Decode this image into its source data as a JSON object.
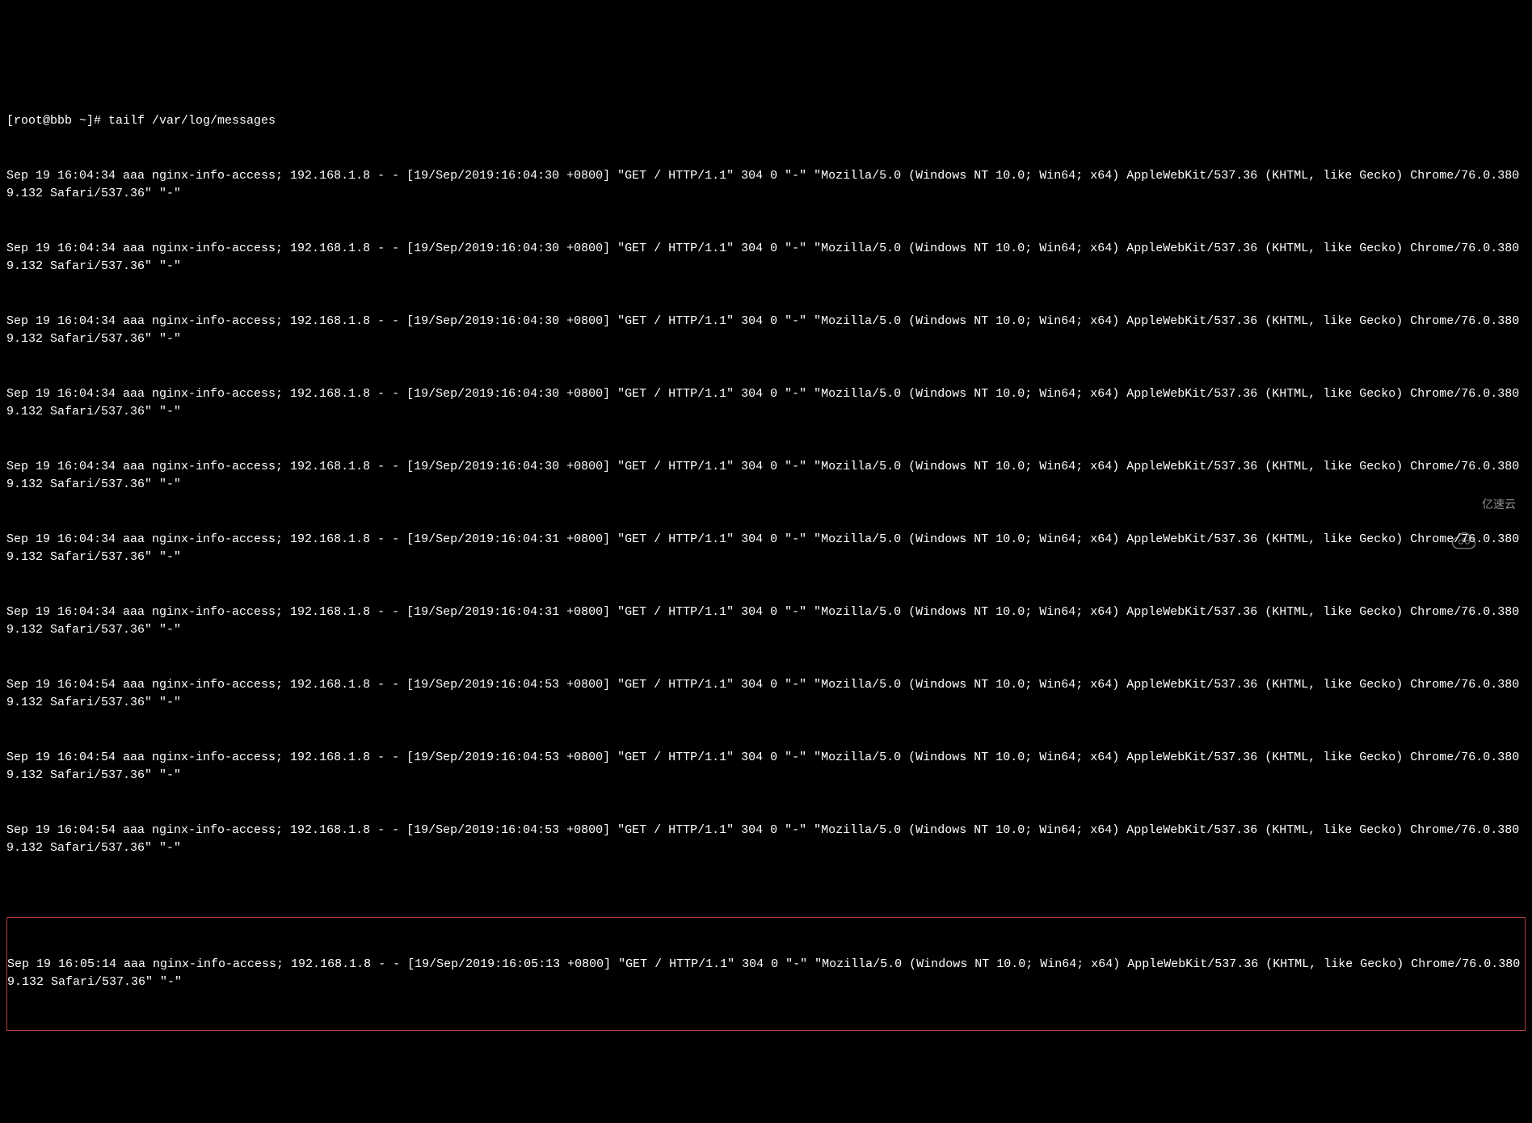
{
  "terminal": {
    "prompt": "[root@bbb ~]# tailf /var/log/messages",
    "log_lines": [
      "Sep 19 16:04:34 aaa nginx-info-access; 192.168.1.8 - - [19/Sep/2019:16:04:30 +0800] \"GET / HTTP/1.1\" 304 0 \"-\" \"Mozilla/5.0 (Windows NT 10.0; Win64; x64) AppleWebKit/537.36 (KHTML, like Gecko) Chrome/76.0.3809.132 Safari/537.36\" \"-\"",
      "Sep 19 16:04:34 aaa nginx-info-access; 192.168.1.8 - - [19/Sep/2019:16:04:30 +0800] \"GET / HTTP/1.1\" 304 0 \"-\" \"Mozilla/5.0 (Windows NT 10.0; Win64; x64) AppleWebKit/537.36 (KHTML, like Gecko) Chrome/76.0.3809.132 Safari/537.36\" \"-\"",
      "Sep 19 16:04:34 aaa nginx-info-access; 192.168.1.8 - - [19/Sep/2019:16:04:30 +0800] \"GET / HTTP/1.1\" 304 0 \"-\" \"Mozilla/5.0 (Windows NT 10.0; Win64; x64) AppleWebKit/537.36 (KHTML, like Gecko) Chrome/76.0.3809.132 Safari/537.36\" \"-\"",
      "Sep 19 16:04:34 aaa nginx-info-access; 192.168.1.8 - - [19/Sep/2019:16:04:30 +0800] \"GET / HTTP/1.1\" 304 0 \"-\" \"Mozilla/5.0 (Windows NT 10.0; Win64; x64) AppleWebKit/537.36 (KHTML, like Gecko) Chrome/76.0.3809.132 Safari/537.36\" \"-\"",
      "Sep 19 16:04:34 aaa nginx-info-access; 192.168.1.8 - - [19/Sep/2019:16:04:30 +0800] \"GET / HTTP/1.1\" 304 0 \"-\" \"Mozilla/5.0 (Windows NT 10.0; Win64; x64) AppleWebKit/537.36 (KHTML, like Gecko) Chrome/76.0.3809.132 Safari/537.36\" \"-\"",
      "Sep 19 16:04:34 aaa nginx-info-access; 192.168.1.8 - - [19/Sep/2019:16:04:31 +0800] \"GET / HTTP/1.1\" 304 0 \"-\" \"Mozilla/5.0 (Windows NT 10.0; Win64; x64) AppleWebKit/537.36 (KHTML, like Gecko) Chrome/76.0.3809.132 Safari/537.36\" \"-\"",
      "Sep 19 16:04:34 aaa nginx-info-access; 192.168.1.8 - - [19/Sep/2019:16:04:31 +0800] \"GET / HTTP/1.1\" 304 0 \"-\" \"Mozilla/5.0 (Windows NT 10.0; Win64; x64) AppleWebKit/537.36 (KHTML, like Gecko) Chrome/76.0.3809.132 Safari/537.36\" \"-\"",
      "Sep 19 16:04:54 aaa nginx-info-access; 192.168.1.8 - - [19/Sep/2019:16:04:53 +0800] \"GET / HTTP/1.1\" 304 0 \"-\" \"Mozilla/5.0 (Windows NT 10.0; Win64; x64) AppleWebKit/537.36 (KHTML, like Gecko) Chrome/76.0.3809.132 Safari/537.36\" \"-\"",
      "Sep 19 16:04:54 aaa nginx-info-access; 192.168.1.8 - - [19/Sep/2019:16:04:53 +0800] \"GET / HTTP/1.1\" 304 0 \"-\" \"Mozilla/5.0 (Windows NT 10.0; Win64; x64) AppleWebKit/537.36 (KHTML, like Gecko) Chrome/76.0.3809.132 Safari/537.36\" \"-\"",
      "Sep 19 16:04:54 aaa nginx-info-access; 192.168.1.8 - - [19/Sep/2019:16:04:53 +0800] \"GET / HTTP/1.1\" 304 0 \"-\" \"Mozilla/5.0 (Windows NT 10.0; Win64; x64) AppleWebKit/537.36 (KHTML, like Gecko) Chrome/76.0.3809.132 Safari/537.36\" \"-\""
    ],
    "highlighted_line": "Sep 19 16:05:14 aaa nginx-info-access; 192.168.1.8 - - [19/Sep/2019:16:05:13 +0800] \"GET / HTTP/1.1\" 304 0 \"-\" \"Mozilla/5.0 (Windows NT 10.0; Win64; x64) AppleWebKit/537.36 (KHTML, like Gecko) Chrome/76.0.3809.132 Safari/537.36\" \"-\""
  },
  "watermark": {
    "text": "亿速云"
  }
}
